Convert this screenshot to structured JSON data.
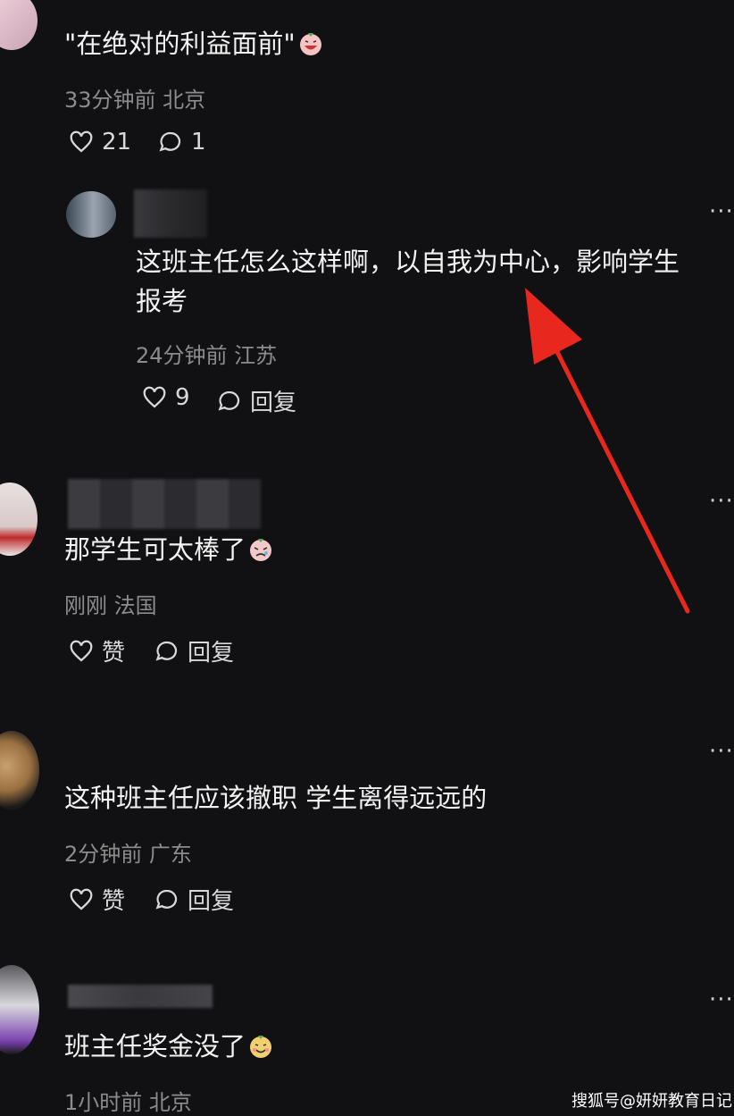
{
  "comments": [
    {
      "text": "\"在绝对的利益面前\"",
      "meta": "33分钟前 北京",
      "likes": "21",
      "replies": "1"
    },
    {
      "text_line1": "这班主任怎么这样啊，以自我为中心，影响学生",
      "text_line2": "报考",
      "meta": "24分钟前 江苏",
      "likes": "9",
      "reply_label": "回复"
    },
    {
      "text": "那学生可太棒了",
      "meta": "刚刚 法国",
      "like_label": "赞",
      "reply_label": "回复"
    },
    {
      "text": "这种班主任应该撤职 学生离得远远的",
      "meta": "2分钟前 广东",
      "like_label": "赞",
      "reply_label": "回复"
    },
    {
      "text": "班主任奖金没了",
      "meta": "1小时前 北京"
    }
  ],
  "more_glyph": "···",
  "watermark": "搜狐号@妍妍教育日记",
  "colors": {
    "background": "#111113",
    "text": "#f2f2f2",
    "meta": "#8c8c8c",
    "arrow": "#e8281e"
  }
}
